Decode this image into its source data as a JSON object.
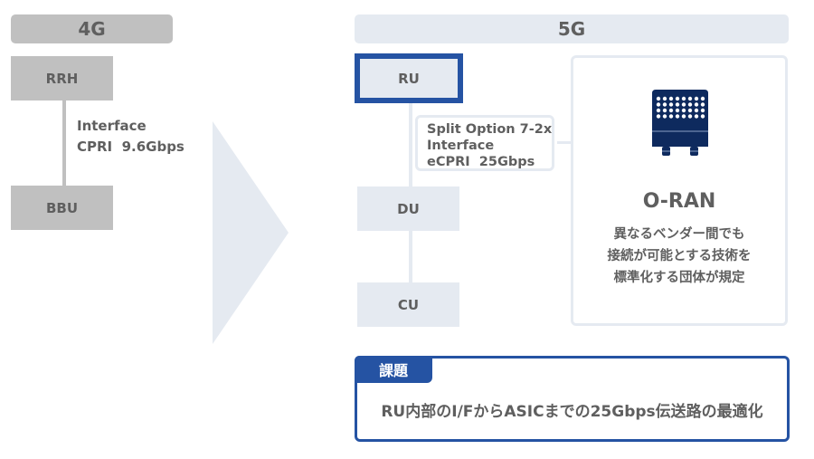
{
  "gen4": {
    "header": "4G",
    "top_box": "RRH",
    "bottom_box": "BBU",
    "interface_lines": [
      "Interface",
      "CPRI  9.6Gbps"
    ]
  },
  "gen5": {
    "header": "5G",
    "boxes": [
      "RU",
      "DU",
      "CU"
    ],
    "interface_lines": [
      "Split Option 7-2x",
      "Interface",
      "eCPRI  25Gbps"
    ],
    "oran": {
      "icon": "radio-unit-icon",
      "title": "O-RAN",
      "description": [
        "異なるベンダー間でも",
        "接続が可能とする技術を",
        "標準化する団体が規定"
      ]
    }
  },
  "issue": {
    "tag": "課題",
    "text": "RU内部のI/FからASICまでの25Gbps伝送路の最適化"
  },
  "colors": {
    "gray": "#c0c0c0",
    "light_blue": "#e5eaf1",
    "accent_blue": "#2553a3",
    "navy": "#0e2a5e",
    "text": "#5f5f5f"
  }
}
